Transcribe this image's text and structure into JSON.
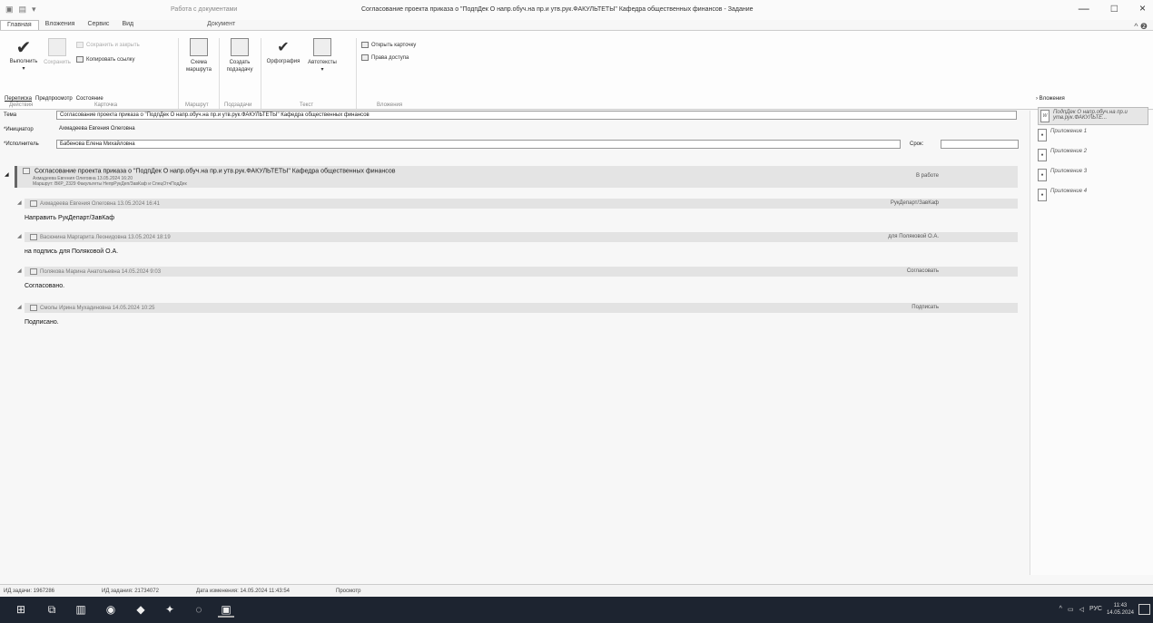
{
  "titlebar": {
    "context_tab": "Работа с документами",
    "window_title": "Согласование проекта приказа о \"ПодпДек О напр.обуч.на пр.и утв.рук.ФАКУЛЬТЕТЫ\" Кафедра общественных финансов - Задание",
    "minimize": "—",
    "maximize": "□",
    "close": "×",
    "help": "^ ❷"
  },
  "tabs": [
    "Главная",
    "Вложения",
    "Сервис",
    "Вид"
  ],
  "doc_tab": "Документ",
  "ribbon": {
    "execute": "Выполнить",
    "save": "Сохранить",
    "save_and_close": "Сохранить и закрыть",
    "copy_link": "Копировать ссылку",
    "route_scheme_1": "Схема",
    "route_scheme_2": "маршрута",
    "create_1": "Создать",
    "create_2": "подзадачу",
    "spelling": "Орфография",
    "autotexts": "Автотексты",
    "open_card": "Открыть карточку",
    "access_rights": "Права доступа",
    "groups": {
      "actions": "Действия",
      "card": "Карточка",
      "route": "Маршрут",
      "subtasks": "Подзадачи",
      "text": "Текст",
      "attachments": "Вложения"
    }
  },
  "subtabs": [
    "Переписка",
    "Предпросмотр",
    "Состояние"
  ],
  "fields": {
    "subject_label": "Тема",
    "subject_value": "Согласование проекта приказа о \"ПодпДек О напр.обуч.на пр.и утв.рук.ФАКУЛЬТЕТЫ\" Кафедра общественных финансов",
    "initiator_label": "*Инициатор",
    "initiator_value": "Ахмадеева Евгения Олеговна",
    "executor_label": "*Исполнитель",
    "executor_value": "Бабенова Елена Михайловна",
    "deadline_label": "Срок:",
    "deadline_value": ""
  },
  "task": {
    "title": "Согласование проекта приказа о \"ПодпДек О напр.обуч.на пр.и утв.рук.ФАКУЛЬТЕТЫ\" Кафедра общественных финансов",
    "meta": "Ахмадеева Евгения Олеговна 13.05.2024 16:20",
    "route": "Маршрут: ВКР_2329 Факультеты НепрРукДеп/ЗавКаф и СпецОтчПодДек",
    "status": "В работе"
  },
  "entries": [
    {
      "header": "Ахмадеева Евгения Олеговна 13.05.2024 16:41",
      "status": "РукДепарт/ЗавКаф",
      "text": "Направить РукДепарт/ЗавКаф"
    },
    {
      "header": "Васюнина Маргарита Леонидовна 13.05.2024 18:19",
      "status": "для Поляковой О.А.",
      "text": "на подпись для Поляковой О.А."
    },
    {
      "header": "Полякова Марина Анатольевна 14.05.2024 9:03",
      "status": "Согласовать",
      "text": "Согласовано."
    },
    {
      "header": "Смолы Ирина Мухадиновна 14.05.2024 10:25",
      "status": "Подписать",
      "text": "Подписано."
    }
  ],
  "attachments": {
    "header": "Вложения",
    "items": [
      "ПодпДек О напр.обуч.на пр.и утв.рук.ФАКУЛЬТЕ...",
      "Приложение 1",
      "Приложение 2",
      "Приложение 3",
      "Приложение 4"
    ]
  },
  "statusbar": {
    "task_id": "ИД задачи: 1967286",
    "assignment_id": "ИД задания: 21734072",
    "changed": "Дата изменения: 14.05.2024 11:43:54",
    "mode": "Просмотр"
  },
  "tray": {
    "lang": "РУС",
    "time": "11:43",
    "date": "14.05.2024"
  }
}
